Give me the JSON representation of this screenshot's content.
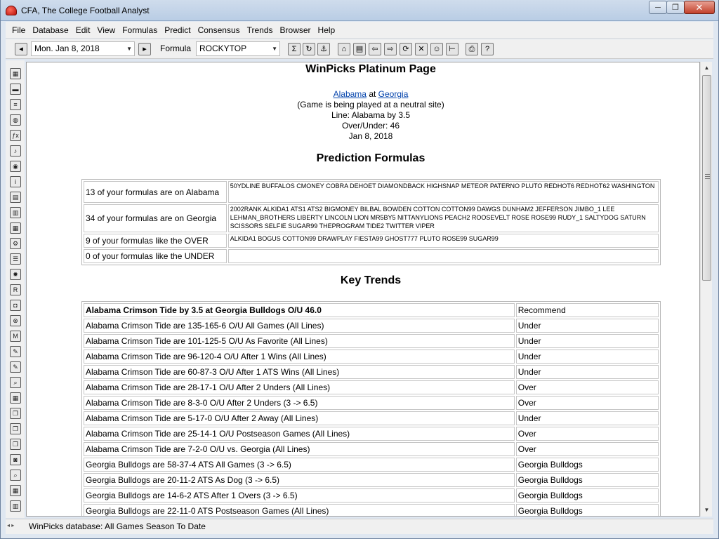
{
  "window": {
    "title": "CFA,  The College Football Analyst",
    "minimize_glyph": "─",
    "maximize_glyph": "❐",
    "close_glyph": "✕"
  },
  "menu": [
    {
      "label": "File"
    },
    {
      "label": "Database"
    },
    {
      "label": "Edit"
    },
    {
      "label": "View"
    },
    {
      "label": "Formulas"
    },
    {
      "label": "Predict"
    },
    {
      "label": "Consensus"
    },
    {
      "label": "Trends"
    },
    {
      "label": "Browser"
    },
    {
      "label": "Help"
    }
  ],
  "toolbar": {
    "date_value": "Mon. Jan  8, 2018",
    "formula_label": "Formula",
    "formula_value": "ROCKYTOP",
    "dropdown_glyph": "▼",
    "icons": [
      {
        "name": "sum-icon",
        "glyph": "Σ"
      },
      {
        "name": "refresh-icon",
        "glyph": "↻"
      },
      {
        "name": "anchor-icon",
        "glyph": "⚓"
      },
      {
        "name": "home-icon",
        "glyph": "⌂"
      },
      {
        "name": "folder-icon",
        "glyph": "▤"
      },
      {
        "name": "back-arrow-icon",
        "glyph": "⇦"
      },
      {
        "name": "forward-arrow-icon",
        "glyph": "⇨"
      },
      {
        "name": "reload-icon",
        "glyph": "⟳"
      },
      {
        "name": "stop-icon",
        "glyph": "✕"
      },
      {
        "name": "person-icon",
        "glyph": "☺"
      },
      {
        "name": "ruler-icon",
        "glyph": "⊢"
      },
      {
        "name": "print-icon",
        "glyph": "⎙"
      },
      {
        "name": "help-icon",
        "glyph": "?"
      }
    ]
  },
  "left_toolbar": [
    {
      "name": "grid-icon",
      "glyph": "▦"
    },
    {
      "name": "keyboard-icon",
      "glyph": "▬"
    },
    {
      "name": "document-icon",
      "glyph": "≡"
    },
    {
      "name": "globe-icon",
      "glyph": "◍"
    },
    {
      "name": "function-icon",
      "glyph": "ƒx"
    },
    {
      "name": "music-note-icon",
      "glyph": "♪"
    },
    {
      "name": "world-icon",
      "glyph": "◉"
    },
    {
      "name": "info-icon",
      "glyph": "i"
    },
    {
      "name": "spreadsheet-icon",
      "glyph": "▤"
    },
    {
      "name": "spreadsheet-yellow-icon",
      "glyph": "▥"
    },
    {
      "name": "spreadsheet-blue-icon",
      "glyph": "▦"
    },
    {
      "name": "settings-icon",
      "glyph": "⚙"
    },
    {
      "name": "list-icon",
      "glyph": "☰"
    },
    {
      "name": "lightbulb-icon",
      "glyph": "✹"
    },
    {
      "name": "ratings-icon",
      "glyph": "R"
    },
    {
      "name": "bag-icon",
      "glyph": "◘"
    },
    {
      "name": "target-icon",
      "glyph": "⊗"
    },
    {
      "name": "moves-icon",
      "glyph": "M"
    },
    {
      "name": "notes-icon",
      "glyph": "✎"
    },
    {
      "name": "notes-2-icon",
      "glyph": "✎"
    },
    {
      "name": "search-icon",
      "glyph": "⌕"
    },
    {
      "name": "calendar-icon",
      "glyph": "▦"
    },
    {
      "name": "copy-icon",
      "glyph": "❐"
    },
    {
      "name": "copy-yellow-icon",
      "glyph": "❐"
    },
    {
      "name": "copy-2-icon",
      "glyph": "❐"
    },
    {
      "name": "camera-icon",
      "glyph": "◙"
    },
    {
      "name": "zoom-icon",
      "glyph": "⌕"
    },
    {
      "name": "calculator-icon",
      "glyph": "▦"
    },
    {
      "name": "book-icon",
      "glyph": "▥"
    }
  ],
  "page": {
    "title": "WinPicks Platinum Page",
    "away_team": "Alabama",
    "at_word": " at ",
    "home_team": "Georgia",
    "neutral_note": "(Game is being played at a neutral site)",
    "line": "Line: Alabama by 3.5",
    "over_under": "Over/Under: 46",
    "date": "Jan 8, 2018",
    "formulas_heading": "Prediction Formulas",
    "formulas": [
      {
        "label": "13 of your formulas are on Alabama",
        "list": "50YDLINE BUFFALOS CMONEY COBRA DEHOET DIAMONDBACK HIGHSNAP METEOR PATERNO PLUTO REDHOT6 REDHOT62 WASHINGTON"
      },
      {
        "label": "34 of your formulas are on Georgia",
        "list": "2002RANK ALKIDA1 ATS1 ATS2 BIGMONEY BILBAL BOWDEN COTTON COTTON99 DAWGS DUNHAM2 JEFFERSON JIMBO_1 LEE LEHMAN_BROTHERS LIBERTY LINCOLN LION MR5BY5 NITTANYLIONS PEACH2 ROOSEVELT ROSE ROSE99 RUDY_1 SALTYDOG SATURN SCISSORS SELFIE SUGAR99 THEPROGRAM TIDE2 TWITTER VIPER"
      },
      {
        "label": "9 of your formulas like the OVER",
        "list": "ALKIDA1 BOGUS COTTON99 DRAWPLAY FIESTA99 GHOST777 PLUTO ROSE99 SUGAR99"
      },
      {
        "label": "0 of your formulas like the UNDER",
        "list": ""
      }
    ],
    "trends_heading": "Key Trends",
    "trends_header": {
      "trend": "Alabama Crimson Tide by 3.5 at Georgia Bulldogs O/U 46.0",
      "recommend": "Recommend"
    },
    "trends": [
      {
        "trend": "Alabama Crimson Tide are 135-165-6 O/U All Games (All Lines)",
        "rec": "Under"
      },
      {
        "trend": "Alabama Crimson Tide are 101-125-5 O/U As Favorite (All Lines)",
        "rec": "Under"
      },
      {
        "trend": "Alabama Crimson Tide are 96-120-4 O/U After 1 Wins (All Lines)",
        "rec": "Under"
      },
      {
        "trend": "Alabama Crimson Tide are 60-87-3 O/U After 1 ATS Wins (All Lines)",
        "rec": "Under"
      },
      {
        "trend": "Alabama Crimson Tide are 28-17-1 O/U After 2 Unders (All Lines)",
        "rec": "Over"
      },
      {
        "trend": "Alabama Crimson Tide are 8-3-0 O/U After 2 Unders (3 -> 6.5)",
        "rec": "Over"
      },
      {
        "trend": "Alabama Crimson Tide are 5-17-0 O/U After 2 Away (All Lines)",
        "rec": "Under"
      },
      {
        "trend": "Alabama Crimson Tide are 25-14-1 O/U Postseason Games (All Lines)",
        "rec": "Over"
      },
      {
        "trend": "Alabama Crimson Tide are 7-2-0 O/U vs. Georgia (All Lines)",
        "rec": "Over"
      },
      {
        "trend": "Georgia Bulldogs are 58-37-4 ATS All Games (3 -> 6.5)",
        "rec": "Georgia Bulldogs"
      },
      {
        "trend": "Georgia Bulldogs are 20-11-2 ATS As Dog (3 -> 6.5)",
        "rec": "Georgia Bulldogs"
      },
      {
        "trend": "Georgia Bulldogs are 14-6-2 ATS After 1 Overs (3 -> 6.5)",
        "rec": "Georgia Bulldogs"
      },
      {
        "trend": "Georgia Bulldogs are 22-11-0 ATS Postseason Games (All Lines)",
        "rec": "Georgia Bulldogs"
      }
    ]
  },
  "scrollbar": {
    "up_glyph": "▲",
    "down_glyph": "▼"
  },
  "status": {
    "arrows": "◂ ▸",
    "text": "WinPicks database:  All Games Season To Date"
  }
}
